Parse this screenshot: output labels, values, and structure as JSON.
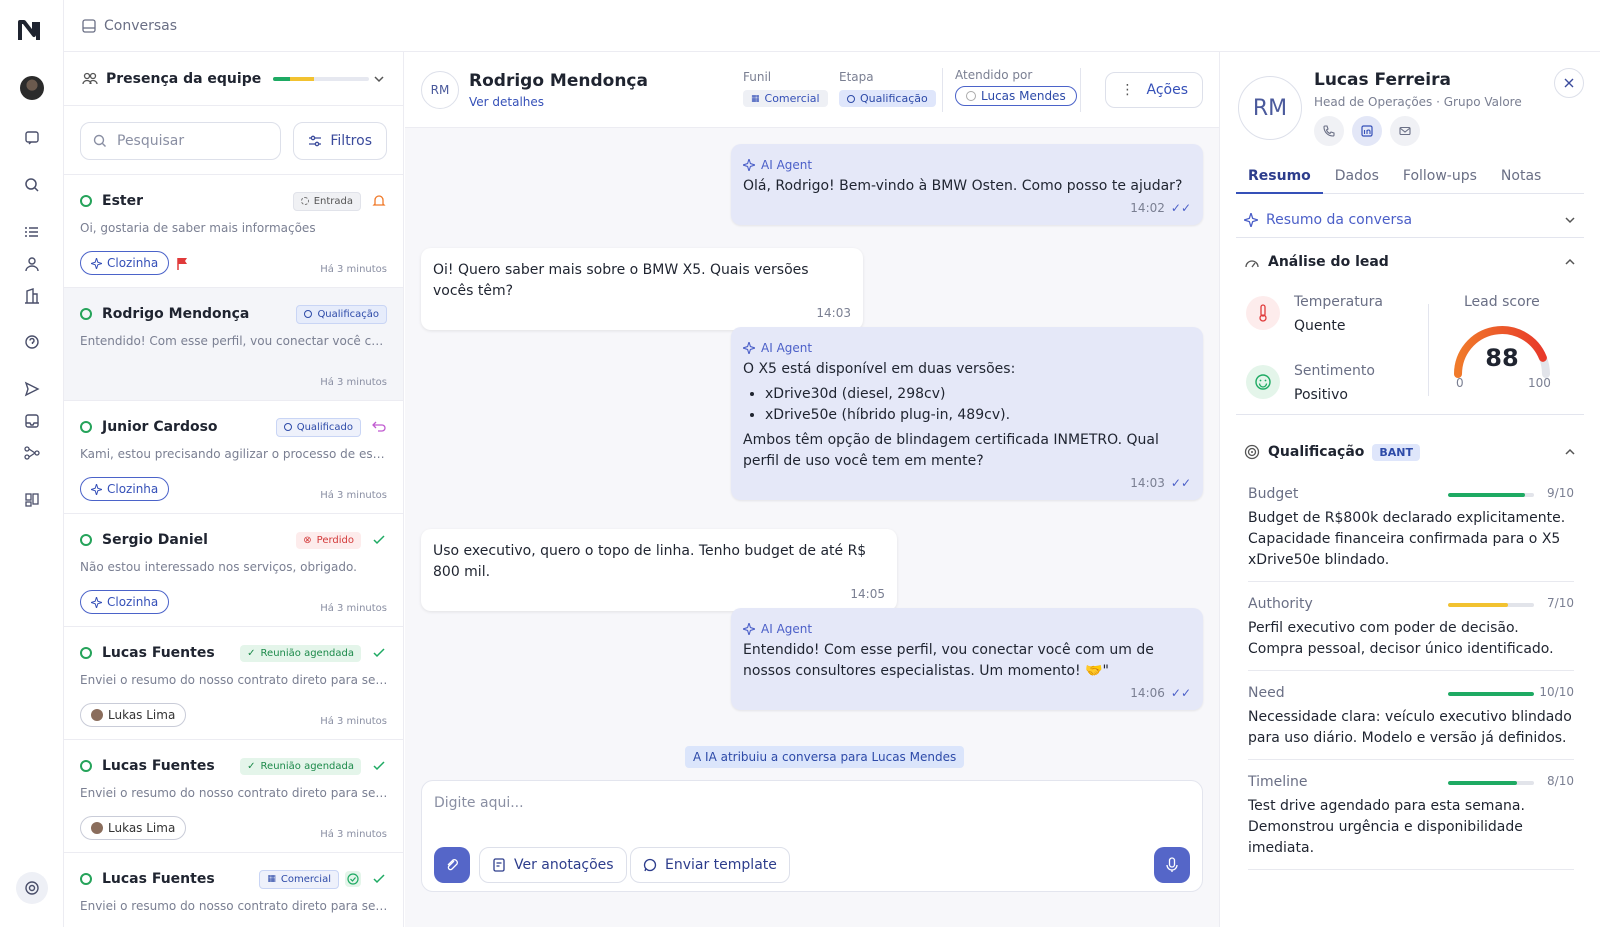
{
  "topbar": {
    "title": "Conversas"
  },
  "list": {
    "presence_label": "Presença da equipe",
    "search_placeholder": "Pesquisar",
    "filters_label": "Filtros",
    "items": [
      {
        "name": "Ester",
        "tag": "Entrada",
        "message": "Oi, gostaria de saber mais informações",
        "pill": "Clozinha",
        "time": "Há 3 minutos"
      },
      {
        "name": "Rodrigo Mendonça",
        "tag": "Qualificação",
        "message": "Entendido! Com esse perfil, vou conectar você com um de nossos consultores especialistas.",
        "pill": "",
        "time": "Há 3 minutos"
      },
      {
        "name": "Junior Cardoso",
        "tag": "Qualificado",
        "message": "Kami, estou precisando agilizar o processo de escritura do imóvel",
        "pill": "Clozinha",
        "time": "Há 3 minutos"
      },
      {
        "name": "Sergio Daniel",
        "tag": "Perdido",
        "message": "Não estou interessado nos serviços, obrigado.",
        "pill": "Clozinha",
        "time": "Há 3 minutos"
      },
      {
        "name": "Lucas Fuentes",
        "tag": "Reunião agendada",
        "message": "Enviei o resumo do nosso contrato direto para seu e-mail",
        "pill": "Lukas Lima",
        "time": "Há 3 minutos"
      },
      {
        "name": "Lucas Fuentes",
        "tag": "Reunião agendada",
        "message": "Enviei o resumo do nosso contrato direto para seu e-mail",
        "pill": "Lukas Lima",
        "time": "Há 3 minutos"
      },
      {
        "name": "Lucas Fuentes",
        "tag": "Comercial",
        "message": "Enviei o resumo do nosso contrato direto para seu e-mail",
        "pill": "",
        "time": ""
      }
    ]
  },
  "chat": {
    "contact_initials": "RM",
    "contact_name": "Rodrigo Mendonça",
    "details_link": "Ver detalhes",
    "funnel_label": "Funil",
    "funnel_value": "Comercial",
    "stage_label": "Etapa",
    "stage_value": "Qualificação",
    "attended_label": "Atendido por",
    "attended_value": "Lucas Mendes",
    "actions_label": "Ações",
    "agent_label": "AI Agent",
    "messages": [
      {
        "text": "Olá, Rodrigo! Bem-vindo à BMW Osten. Como posso te ajudar?",
        "time": "14:02"
      },
      {
        "text": "Oi! Quero saber mais sobre o BMW X5. Quais versões vocês têm?",
        "time": "14:03"
      },
      {
        "text": "O X5 está disponível em duas versões:",
        "bullets": [
          "xDrive30d (diesel, 298cv)",
          "xDrive50e (híbrido plug-in, 489cv)."
        ],
        "text2": "Ambos têm opção de blindagem certificada INMETRO. Qual perfil de uso você tem em mente?",
        "time": "14:03"
      },
      {
        "text": "Uso executivo, quero o topo de linha. Tenho budget de até R$ 800 mil.",
        "time": "14:05"
      },
      {
        "text": "Entendido! Com esse perfil, vou conectar você com um de nossos consultores especialistas. Um momento! 🤝\"",
        "time": "14:06"
      }
    ],
    "assign_notice": "A IA atribuiu a conversa para Lucas Mendes",
    "composer_placeholder": "Digite aqui...",
    "notes_button": "Ver anotações",
    "template_button": "Enviar template"
  },
  "profile": {
    "initials": "RM",
    "name": "Lucas Ferreira",
    "role": "Head de Operações · Grupo Valore",
    "tabs": [
      "Resumo",
      "Dados",
      "Follow-ups",
      "Notas"
    ],
    "summary_label": "Resumo da conversa",
    "analysis_label": "Análise do lead",
    "temp_label": "Temperatura",
    "temp_value": "Quente",
    "sent_label": "Sentimento",
    "sent_value": "Positivo",
    "score_label": "Lead score",
    "score_value": 88,
    "score_min": "0",
    "score_max": "100",
    "qual_label": "Qualificação",
    "qual_badge": "BANT",
    "criteria": [
      {
        "name": "Budget",
        "score": "9/10",
        "level": 0.9,
        "color": "#1eaa63",
        "desc": "Budget de R$800k declarado explicitamente. Capacidade financeira confirmada para o X5 xDrive50e blindado."
      },
      {
        "name": "Authority",
        "score": "7/10",
        "level": 0.7,
        "color": "#f2c230",
        "desc": "Perfil executivo com poder de decisão. Compra pessoal, decisor único identificado."
      },
      {
        "name": "Need",
        "score": "10/10",
        "level": 1.0,
        "color": "#1eaa63",
        "desc": "Necessidade clara: veículo executivo blindado para uso diário. Modelo e versão já definidos."
      },
      {
        "name": "Timeline",
        "score": "8/10",
        "level": 0.8,
        "color": "#1eaa63",
        "desc": "Test drive agendado para esta semana. Demonstrou urgência e disponibilidade imediata."
      }
    ]
  }
}
